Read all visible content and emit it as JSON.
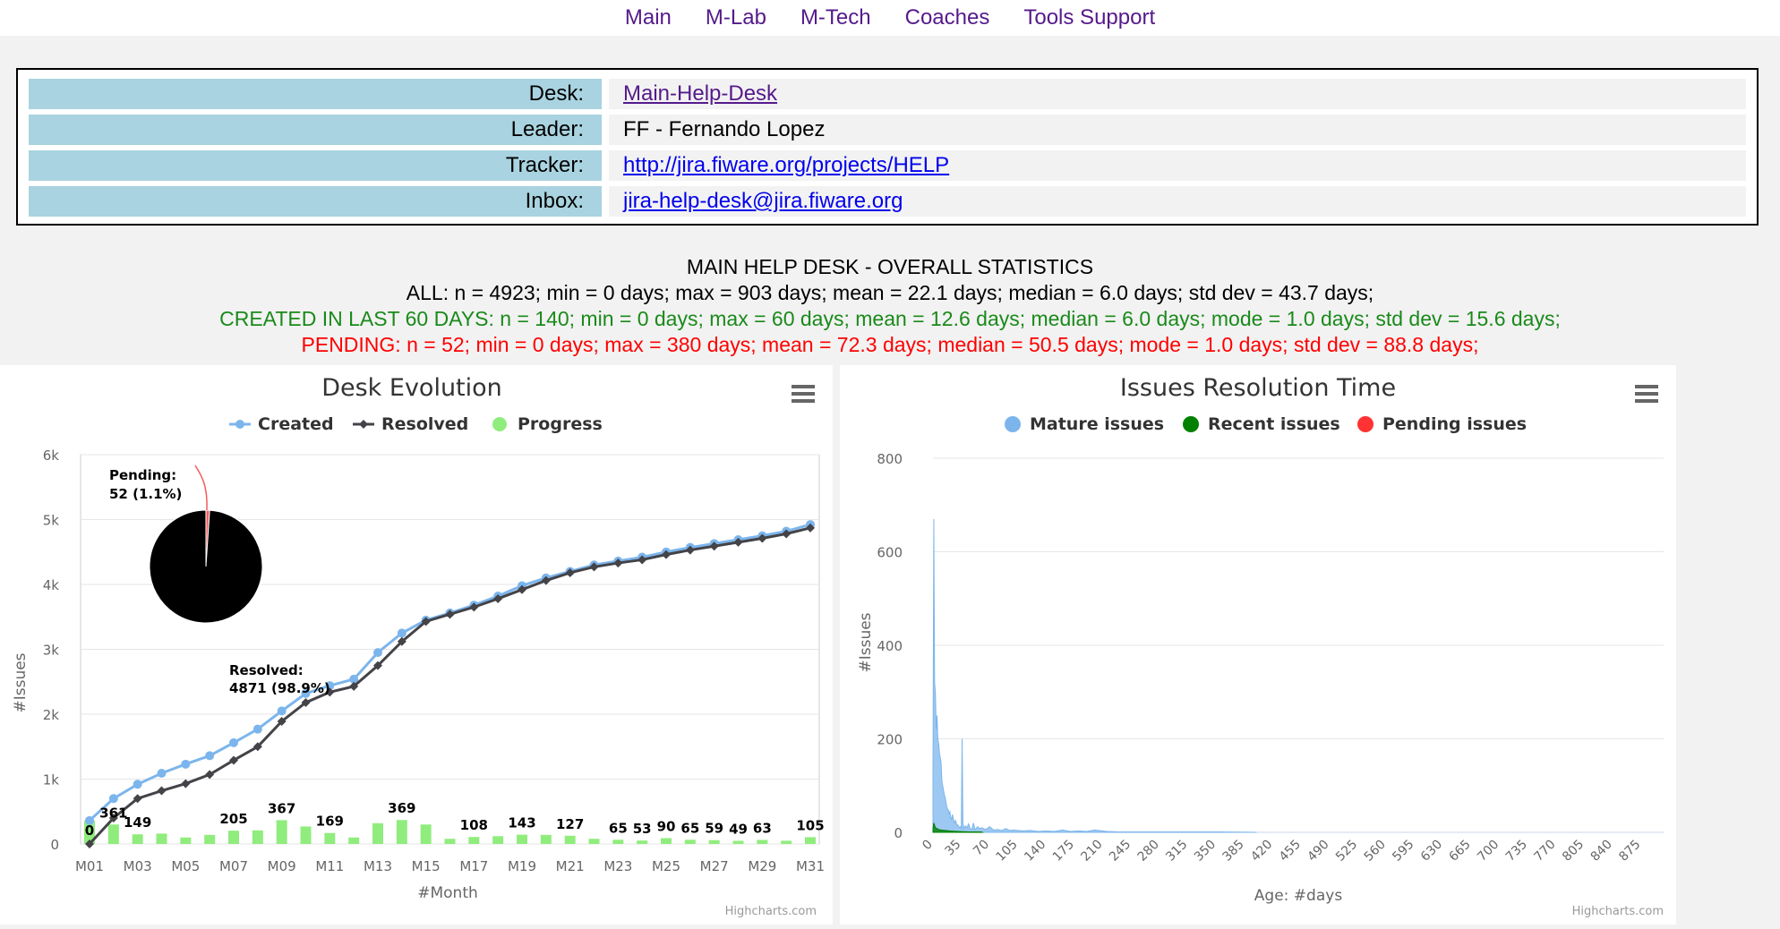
{
  "nav": [
    "Main",
    "M-Lab",
    "M-Tech",
    "Coaches",
    "Tools Support"
  ],
  "info": [
    {
      "label": "Desk:",
      "value": "Main-Help-Desk"
    },
    {
      "label": "Leader:",
      "value": "FF - Fernando Lopez"
    },
    {
      "label": "Tracker:",
      "value": "http://jira.fiware.org/projects/HELP"
    },
    {
      "label": "Inbox:",
      "value": "jira-help-desk@jira.fiware.org"
    }
  ],
  "stats": {
    "title": "MAIN HELP DESK - OVERALL STATISTICS",
    "all": "ALL: n = 4923; min = 0 days; max = 903 days; mean = 22.1 days; median = 6.0 days; std dev = 43.7 days;",
    "recent": "CREATED IN LAST 60 DAYS: n = 140; min = 0 days; max = 60 days; mean = 12.6 days; median = 6.0 days; mode = 1.0 days; std dev = 15.6 days;",
    "pending": "PENDING: n = 52; min = 0 days; max = 380 days; mean = 72.3 days; median = 50.5 days; mode = 1.0 days; std dev = 88.8 days;"
  },
  "chart_data": [
    {
      "type": "line",
      "title": "Desk Evolution",
      "xlabel": "#Month",
      "ylabel": "#Issues",
      "ylim": [
        0,
        6000
      ],
      "yticks": [
        "0",
        "1k",
        "2k",
        "3k",
        "4k",
        "5k",
        "6k"
      ],
      "categories": [
        "M01",
        "M02",
        "M03",
        "M04",
        "M05",
        "M06",
        "M07",
        "M08",
        "M09",
        "M10",
        "M11",
        "M12",
        "M13",
        "M14",
        "M15",
        "M16",
        "M17",
        "M18",
        "M19",
        "M20",
        "M21",
        "M22",
        "M23",
        "M24",
        "M25",
        "M26",
        "M27",
        "M28",
        "M29",
        "M30",
        "M31"
      ],
      "xtick_labels": [
        "M01",
        "M03",
        "M05",
        "M07",
        "M09",
        "M11",
        "M13",
        "M15",
        "M17",
        "M19",
        "M21",
        "M23",
        "M25",
        "M27",
        "M29",
        "M31"
      ],
      "series": [
        {
          "name": "Created",
          "color": "#7cb5ec",
          "values": [
            361,
            700,
            920,
            1090,
            1230,
            1360,
            1560,
            1770,
            2050,
            2320,
            2440,
            2540,
            2950,
            3250,
            3450,
            3560,
            3680,
            3820,
            3980,
            4100,
            4200,
            4300,
            4360,
            4420,
            4500,
            4570,
            4630,
            4690,
            4750,
            4820,
            4923
          ]
        },
        {
          "name": "Resolved",
          "color": "#434348",
          "values": [
            0,
            400,
            700,
            820,
            930,
            1070,
            1290,
            1500,
            1890,
            2180,
            2340,
            2430,
            2750,
            3120,
            3430,
            3540,
            3650,
            3780,
            3920,
            4060,
            4180,
            4270,
            4330,
            4380,
            4460,
            4530,
            4590,
            4650,
            4710,
            4780,
            4871
          ]
        },
        {
          "name": "Progress",
          "color": "#90ed7d",
          "values": [
            361,
            300,
            149,
            160,
            100,
            140,
            205,
            210,
            367,
            270,
            169,
            100,
            320,
            369,
            300,
            80,
            108,
            120,
            143,
            140,
            127,
            80,
            65,
            53,
            90,
            65,
            59,
            49,
            63,
            50,
            105
          ]
        }
      ],
      "data_labels": {
        "M01": "0",
        "M02": "361",
        "M03": "149",
        "M07": "205",
        "M09": "367",
        "M11": "169",
        "M14": "369",
        "M17": "108",
        "M19": "143",
        "M21": "127",
        "M23": "65",
        "M24": "53",
        "M25": "90",
        "M26": "65",
        "M27": "59",
        "M28": "49",
        "M29": "63",
        "M31": "105"
      },
      "pie": [
        {
          "name": "Pending",
          "value": 52,
          "label": "Pending:",
          "label2": "52 (1.1%)",
          "color": "#f45b5b"
        },
        {
          "name": "Resolved",
          "value": 4871,
          "label": "Resolved:",
          "label2": "4871 (98.9%)",
          "color": "#000000"
        }
      ],
      "credit": "Highcharts.com",
      "legend": "top-center"
    },
    {
      "type": "area",
      "title": "Issues Resolution Time",
      "xlabel": "Age: #days",
      "ylabel": "#Issues",
      "ylim": [
        0,
        800
      ],
      "yticks": [
        "0",
        "200",
        "400",
        "600",
        "800"
      ],
      "xlim": [
        0,
        903
      ],
      "xtick_labels": [
        "0",
        "35",
        "70",
        "105",
        "140",
        "175",
        "210",
        "245",
        "280",
        "315",
        "350",
        "385",
        "420",
        "455",
        "490",
        "525",
        "560",
        "595",
        "630",
        "665",
        "700",
        "735",
        "770",
        "805",
        "840",
        "875"
      ],
      "series": [
        {
          "name": "Mature issues",
          "color": "#7cb5ec"
        },
        {
          "name": "Recent issues",
          "color": "#008000"
        },
        {
          "name": "Pending issues",
          "color": "#ff3333"
        }
      ],
      "mature_points": [
        [
          0,
          120
        ],
        [
          1,
          670
        ],
        [
          2,
          320
        ],
        [
          3,
          300
        ],
        [
          4,
          220
        ],
        [
          5,
          250
        ],
        [
          6,
          200
        ],
        [
          7,
          190
        ],
        [
          8,
          170
        ],
        [
          9,
          160
        ],
        [
          10,
          150
        ],
        [
          11,
          110
        ],
        [
          12,
          100
        ],
        [
          13,
          90
        ],
        [
          14,
          80
        ],
        [
          15,
          75
        ],
        [
          16,
          65
        ],
        [
          17,
          55
        ],
        [
          18,
          50
        ],
        [
          19,
          48
        ],
        [
          20,
          40
        ],
        [
          21,
          44
        ],
        [
          22,
          30
        ],
        [
          23,
          28
        ],
        [
          24,
          38
        ],
        [
          25,
          30
        ],
        [
          26,
          24
        ],
        [
          27,
          20
        ],
        [
          28,
          25
        ],
        [
          29,
          18
        ],
        [
          30,
          14
        ],
        [
          31,
          16
        ],
        [
          32,
          12
        ],
        [
          33,
          10
        ],
        [
          34,
          12
        ],
        [
          35,
          9
        ],
        [
          36,
          200
        ],
        [
          37,
          20
        ],
        [
          38,
          8
        ],
        [
          40,
          14
        ],
        [
          42,
          10
        ],
        [
          44,
          18
        ],
        [
          46,
          8
        ],
        [
          48,
          6
        ],
        [
          50,
          20
        ],
        [
          52,
          5
        ],
        [
          55,
          12
        ],
        [
          58,
          8
        ],
        [
          60,
          10
        ],
        [
          65,
          6
        ],
        [
          70,
          12
        ],
        [
          75,
          5
        ],
        [
          80,
          6
        ],
        [
          85,
          4
        ],
        [
          90,
          8
        ],
        [
          95,
          4
        ],
        [
          100,
          5
        ],
        [
          110,
          3
        ],
        [
          120,
          4
        ],
        [
          130,
          2
        ],
        [
          140,
          3
        ],
        [
          150,
          2
        ],
        [
          160,
          5
        ],
        [
          170,
          2
        ],
        [
          180,
          3
        ],
        [
          190,
          2
        ],
        [
          200,
          5
        ],
        [
          215,
          2
        ],
        [
          230,
          1
        ],
        [
          260,
          1
        ],
        [
          300,
          1
        ],
        [
          350,
          1
        ],
        [
          400,
          0
        ]
      ],
      "recent_points": [
        [
          0,
          8
        ],
        [
          1,
          20
        ],
        [
          2,
          15
        ],
        [
          3,
          10
        ],
        [
          5,
          8
        ],
        [
          7,
          6
        ],
        [
          10,
          5
        ],
        [
          15,
          4
        ],
        [
          20,
          3
        ],
        [
          30,
          2
        ],
        [
          45,
          1
        ],
        [
          60,
          1
        ],
        [
          61,
          0
        ]
      ],
      "credit": "Highcharts.com",
      "legend": "top-center"
    }
  ]
}
